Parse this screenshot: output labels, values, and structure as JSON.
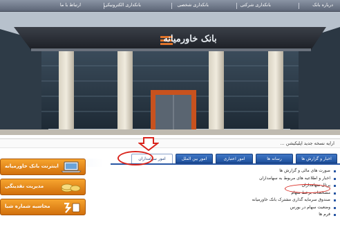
{
  "nav": {
    "items": [
      "درباره بانک",
      "بانکداری شرکتی",
      "بانکداری شخصی",
      "بانکداری الکترونیکی",
      "ارتباط با ما"
    ]
  },
  "hero": {
    "sign_text": "بانک خاورمیانه"
  },
  "ticker": {
    "text": "ارایه نسخه جدید اپلیکیشن ..."
  },
  "tabs": [
    {
      "label": "اخبار و گزارش ها"
    },
    {
      "label": "رسانه ها"
    },
    {
      "label": "امور اعتباری"
    },
    {
      "label": "امور بین الملل"
    },
    {
      "label": "امور سهامداران",
      "active": true
    }
  ],
  "shareholder_items": [
    "صورت های مالی و گزارش ها",
    "اخبار و اطلاعیه های مربوط به سهامداران",
    "پرتال سهامداران",
    "مشخصات برخط سهام",
    "صندوق سرمایه گذاری مشترک بانک خاورمیانه",
    "وضعیت سهام در بورس",
    "فرم ها"
  ],
  "ads": [
    {
      "label": "اینترنت بانک خاورمیانه",
      "icon": "laptop-icon"
    },
    {
      "label": "مدیریت نقدینگی",
      "icon": "coins-icon"
    },
    {
      "label": "محاسبه شماره شبا",
      "icon": "calculator-icon"
    }
  ],
  "colors": {
    "nav": "#5d6677",
    "tab": "#2856a3",
    "ad": "#e8891e",
    "annotation": "#d9241c"
  }
}
